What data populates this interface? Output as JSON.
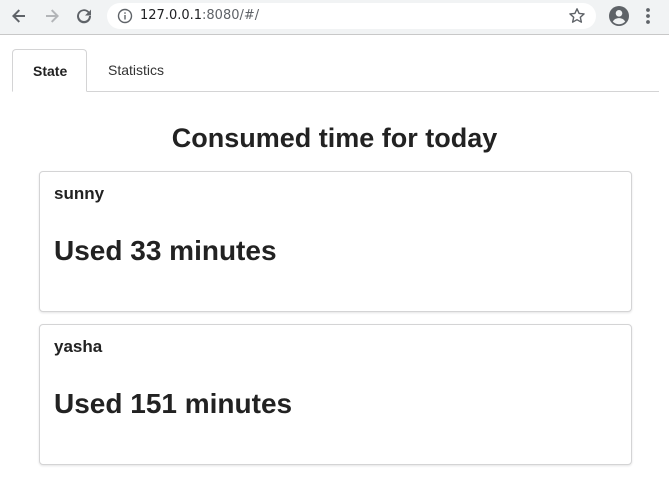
{
  "browser": {
    "url_host": "127.0.0.1",
    "url_rest": ":8080/#/",
    "icons": {
      "back": "back-arrow-icon",
      "forward": "forward-arrow-icon",
      "reload": "reload-icon",
      "info": "info-icon",
      "bookmark": "star-icon",
      "account": "account-icon",
      "menu": "kebab-menu-icon"
    }
  },
  "tabs": [
    {
      "label": "State",
      "active": true
    },
    {
      "label": "Statistics",
      "active": false
    }
  ],
  "main": {
    "title": "Consumed time for today",
    "users": [
      {
        "name": "sunny",
        "usage": "Used 33 minutes"
      },
      {
        "name": "yasha",
        "usage": "Used 151 minutes"
      }
    ]
  }
}
